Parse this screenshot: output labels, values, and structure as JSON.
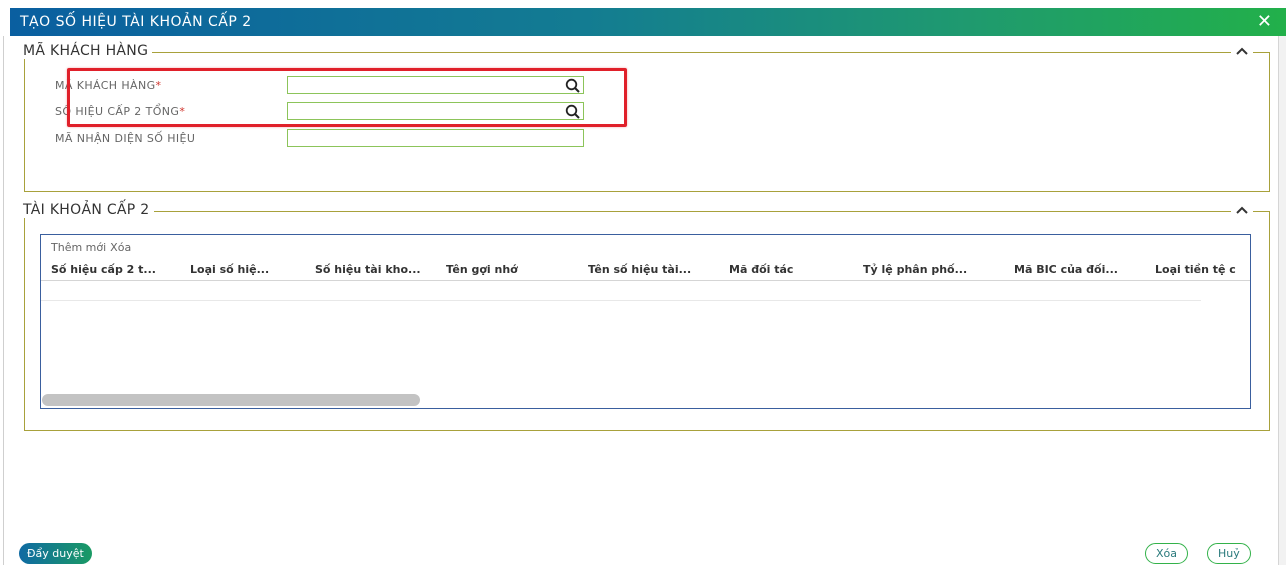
{
  "dialog": {
    "title": "TẠO SỐ HIỆU TÀI KHOẢN CẤP 2",
    "close_symbol": "✕"
  },
  "customer_section": {
    "legend": "MÃ KHÁCH HÀNG",
    "fields": [
      {
        "label": "MÃ KHÁCH HÀNG",
        "required_mark": "*",
        "value": "",
        "has_search": true
      },
      {
        "label": "SỐ HIỆU CẤP 2 TỔNG",
        "required_mark": "*",
        "value": "",
        "has_search": true
      },
      {
        "label": "MÃ NHẬN DIỆN SỐ HIỆU",
        "required_mark": "",
        "value": "",
        "has_search": false
      }
    ]
  },
  "account_section": {
    "legend": "TÀI KHOẢN CẤP 2",
    "toolbar": {
      "add_label": "Thêm mới",
      "delete_label": "Xóa"
    },
    "columns": [
      "Số hiệu cấp 2 t...",
      "Loại số hiệ...",
      "Số hiệu tài kho...",
      "Tên gợi nhớ",
      "Tên số hiệu tài...",
      "Mã đối tác",
      "Tỷ lệ phân phố...",
      "Mã BIC của đối...",
      "Loại tiền tệ c"
    ],
    "rows": []
  },
  "footer": {
    "submit_label": "Đẩy duyệt",
    "delete_label": "Xóa",
    "cancel_label": "Huỷ"
  },
  "colors": {
    "title_gradient_start": "#0a5fa0",
    "title_gradient_end": "#22b04a",
    "highlight": "#e0202a",
    "fieldset_border": "#a8a13b",
    "input_border": "#8cc45a"
  },
  "icons": {
    "search": "search-icon",
    "collapse": "chevron-up-icon",
    "close": "close-icon"
  }
}
